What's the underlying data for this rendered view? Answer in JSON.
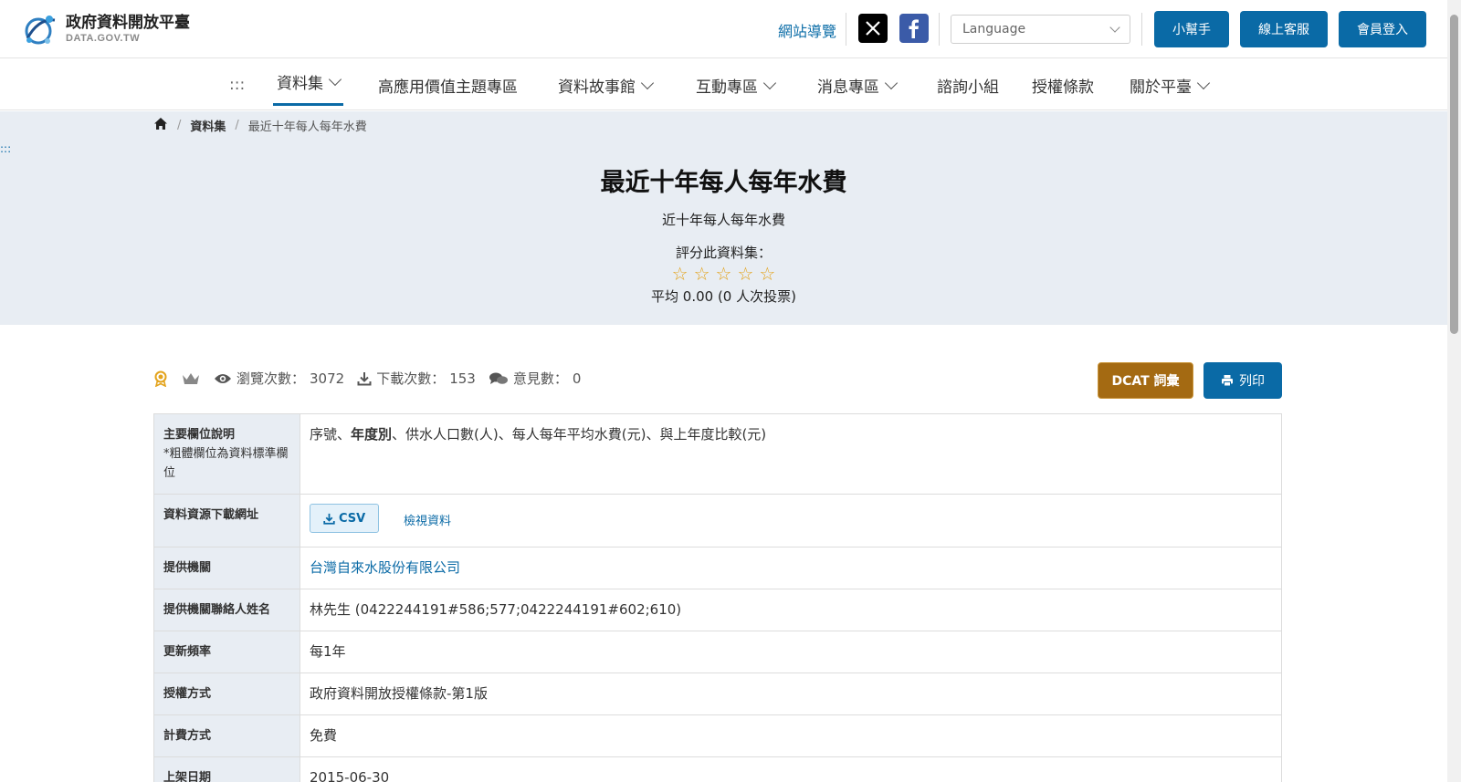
{
  "header": {
    "logo_title": "政府資料開放平臺",
    "logo_sub": "DATA.GOV.TW",
    "sitemap_label": "網站導覽",
    "language_placeholder": "Language",
    "helper_label": "小幫手",
    "service_label": "線上客服",
    "login_label": "會員登入"
  },
  "nav": {
    "skip": ":::",
    "items": [
      {
        "label": "資料集"
      },
      {
        "label": "高應用價值主題專區"
      },
      {
        "label": "資料故事館"
      },
      {
        "label": "互動專區"
      },
      {
        "label": "消息專區"
      },
      {
        "label": "諮詢小組"
      },
      {
        "label": "授權條款"
      },
      {
        "label": "關於平臺"
      }
    ]
  },
  "breadcrumb": {
    "section": "資料集",
    "current": "最近十年每人每年水費"
  },
  "hero": {
    "skip": ":::",
    "title": "最近十年每人每年水費",
    "subtitle": "近十年每人每年水費",
    "rate_label": "評分此資料集：",
    "stars": 5,
    "average_text": "平均 0.00 (0 人次投票)"
  },
  "stats": {
    "views_label": "瀏覽次數：",
    "views": "3072",
    "downloads_label": "下載次數：",
    "downloads": "153",
    "comments_label": "意見數：",
    "comments": "0"
  },
  "actions": {
    "dcat_label": "DCAT 詞彙",
    "print_label": "列印"
  },
  "table": {
    "fields_label": "主要欄位說明",
    "fields_note": "*粗體欄位為資料標準欄位",
    "fields_part1": "序號、",
    "fields_bold": "年度別",
    "fields_part2": "、供水人口數(人)、每人每年平均水費(元)、與上年度比較(元)",
    "download_label": "資料資源下載網址",
    "csv_label": "CSV",
    "view_label": "檢視資料",
    "org_label": "提供機關",
    "org_value": "台灣自來水股份有限公司",
    "contact_label": "提供機關聯絡人姓名",
    "contact_value": "林先生 (0422244191#586;577;0422244191#602;610)",
    "freq_label": "更新頻率",
    "freq_value": "每1年",
    "license_label": "授權方式",
    "license_value": "政府資料開放授權條款-第1版",
    "fee_label": "計費方式",
    "fee_value": "免費",
    "date_label": "上架日期",
    "date_value": "2015-06-30"
  },
  "colors": {
    "primary": "#0a6aa6",
    "dcat": "#a46a12",
    "hero_bg": "#e8edf3",
    "star": "#e3a31c"
  }
}
